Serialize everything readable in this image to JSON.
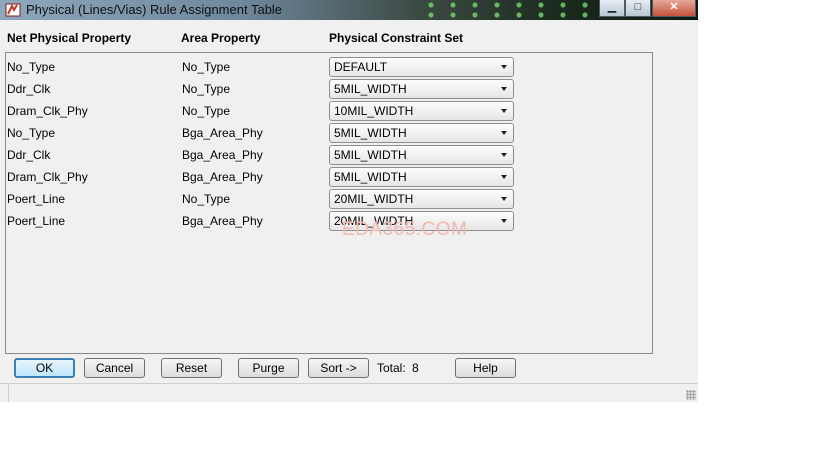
{
  "window": {
    "title": "Physical (Lines/Vias) Rule Assignment Table",
    "minimize_glyph": "▁",
    "maximize_glyph": "□",
    "close_glyph": "✕"
  },
  "table": {
    "columns": [
      "Net Physical Property",
      "Area Property",
      "Physical Constraint Set"
    ],
    "rows": [
      {
        "net": "No_Type",
        "area": "No_Type",
        "constraint": "DEFAULT"
      },
      {
        "net": "Ddr_Clk",
        "area": "No_Type",
        "constraint": "5MIL_WIDTH"
      },
      {
        "net": "Dram_Clk_Phy",
        "area": "No_Type",
        "constraint": "10MIL_WIDTH"
      },
      {
        "net": "No_Type",
        "area": "Bga_Area_Phy",
        "constraint": "5MIL_WIDTH"
      },
      {
        "net": "Ddr_Clk",
        "area": "Bga_Area_Phy",
        "constraint": "5MIL_WIDTH"
      },
      {
        "net": "Dram_Clk_Phy",
        "area": "Bga_Area_Phy",
        "constraint": "5MIL_WIDTH"
      },
      {
        "net": "Poert_Line",
        "area": "No_Type",
        "constraint": "20MIL_WIDTH"
      },
      {
        "net": "Poert_Line",
        "area": "Bga_Area_Phy",
        "constraint": "20MIL_WIDTH"
      }
    ]
  },
  "watermark": "EDA365.COM",
  "buttons": {
    "ok": "OK",
    "cancel": "Cancel",
    "reset": "Reset",
    "purge": "Purge",
    "sort": "Sort ->",
    "help": "Help"
  },
  "total": {
    "label": "Total:",
    "value": "8"
  },
  "colors": {
    "window_bg": "#f0f0f0",
    "default_button_border": "#3c7fb1",
    "watermark": "#f3b8b0"
  }
}
